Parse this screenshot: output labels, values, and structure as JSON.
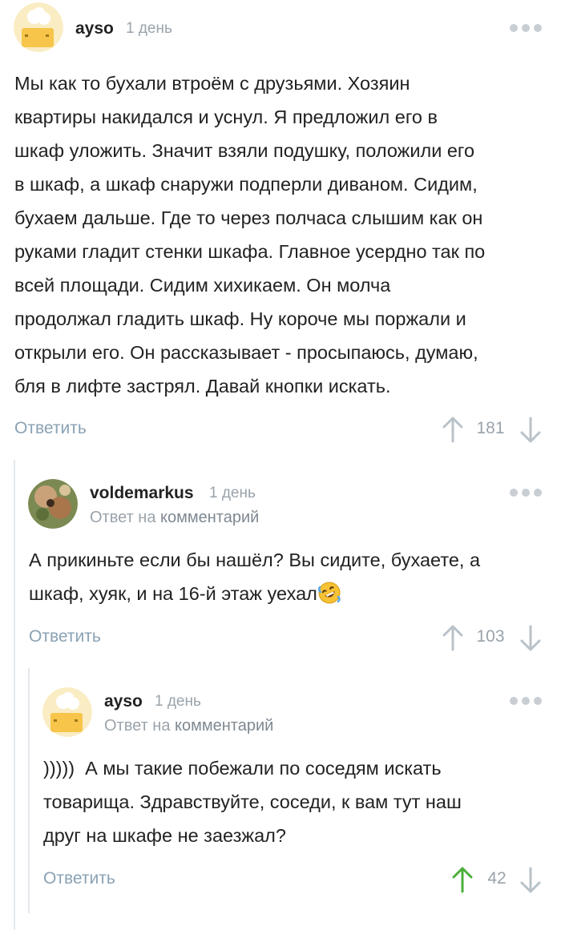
{
  "comments": [
    {
      "username": "ayso",
      "time": "1 день",
      "text_lines": [
        "Мы как то бухали втроём с друзьями. Хозяин",
        "квартиры накидался и уснул. Я предложил его в",
        "шкаф уложить. Значит взяли подушку, положили его",
        "в шкаф, а шкаф снаружи подперли диваном. Сидим,",
        "бухаем дальше. Где то через полчаса слышим как он",
        "руками гладит стенки шкафа. Главное усердно так по",
        "всей площади. Сидим хихикаем. Он молча",
        "продолжал гладить шкаф. Ну короче мы поржали и",
        "открыли его. Он рассказывает - просыпаюсь, думаю,",
        "бля в лифте застрял. Давай кнопки искать."
      ],
      "reply_label": "Ответить",
      "rating": "181"
    },
    {
      "username": "voldemarkus",
      "time": "1 день",
      "reply_prefix": "Ответ на",
      "reply_link": "комментарий",
      "text_lines": [
        "А прикиньте если бы нашёл? Вы сидите, бухаете, а",
        "шкаф, хуяк, и на 16-й этаж уехал"
      ],
      "emoji": "rofl-emoji",
      "reply_label": "Ответить",
      "rating": "103"
    },
    {
      "username": "ayso",
      "time": "1 день",
      "reply_prefix": "Ответ на",
      "reply_link": "комментарий",
      "text_lines": [
        ")))))  А мы такие побежали по соседям искать",
        "товарища. Здравствуйте, соседи, к вам тут наш",
        "друг на шкафе не заезжал?"
      ],
      "reply_label": "Ответить",
      "rating": "42",
      "upvoted": true
    }
  ],
  "colors": {
    "upvote_active": "#4caf3a",
    "arrow_inactive": "#b9c2c9",
    "link": "#8aa2b4"
  }
}
